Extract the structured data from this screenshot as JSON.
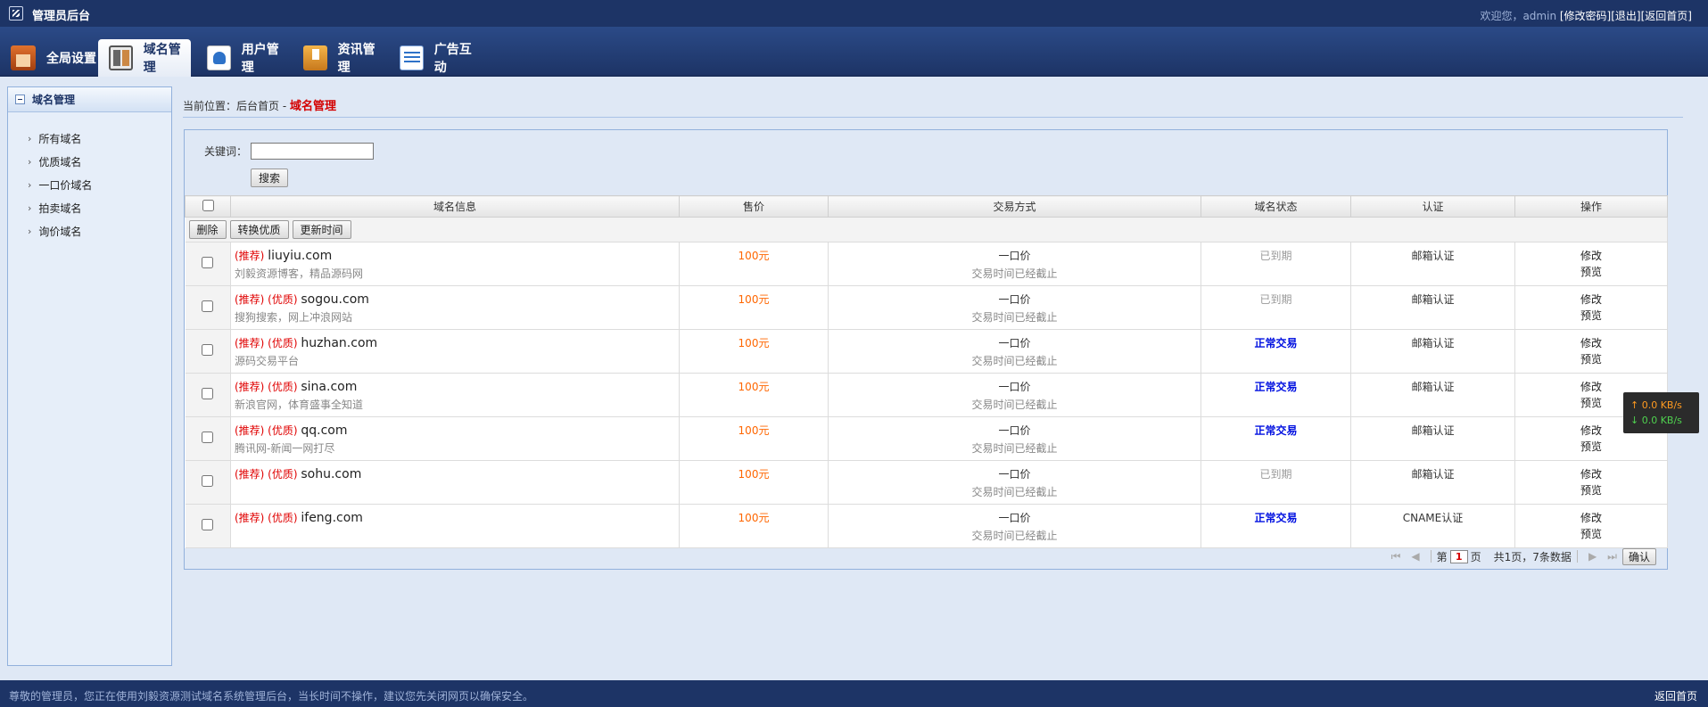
{
  "header": {
    "title": "管理员后台",
    "welcome": "欢迎您，admin ",
    "links": [
      "[修改密码]",
      "[退出]",
      "[返回首页]"
    ]
  },
  "nav": {
    "tabs": [
      {
        "label": "全局设置",
        "icon": "settings-icon"
      },
      {
        "label": "域名管理",
        "icon": "domain-icon",
        "active": true
      },
      {
        "label": "用户管理",
        "icon": "user-icon"
      },
      {
        "label": "资讯管理",
        "icon": "news-icon"
      },
      {
        "label": "广告互动",
        "icon": "ad-icon"
      }
    ]
  },
  "sidebar": {
    "title": "域名管理",
    "items": [
      "所有域名",
      "优质域名",
      "一口价域名",
      "拍卖域名",
      "询价域名"
    ]
  },
  "breadcrumb": {
    "prefix": "当前位置：",
    "home": "后台首页",
    "sep": " - ",
    "current": "域名管理"
  },
  "search": {
    "label": "关键词：",
    "value": "",
    "button": "搜索"
  },
  "table": {
    "headers": [
      "域名信息",
      "售价",
      "交易方式",
      "域名状态",
      "认证",
      "操作"
    ],
    "actions": [
      "删除",
      "转换优质",
      "更新时间"
    ],
    "rows": [
      {
        "tags": "(推荐)",
        "domain": "liuyiu.com",
        "desc": "刘毅资源博客，精品源码网",
        "price": "100元",
        "way": "一口价",
        "way_note": "交易时间已经截止",
        "status": "已到期",
        "status_type": "expired",
        "cert": "邮箱认证",
        "op1": "修改",
        "op2": "预览"
      },
      {
        "tags": "(推荐) (优质)",
        "domain": "sogou.com",
        "desc": "搜狗搜索，网上冲浪网站",
        "price": "100元",
        "way": "一口价",
        "way_note": "交易时间已经截止",
        "status": "已到期",
        "status_type": "expired",
        "cert": "邮箱认证",
        "op1": "修改",
        "op2": "预览"
      },
      {
        "tags": "(推荐) (优质)",
        "domain": "huzhan.com",
        "desc": "源码交易平台",
        "price": "100元",
        "way": "一口价",
        "way_note": "交易时间已经截止",
        "status": "正常交易",
        "status_type": "normal",
        "cert": "邮箱认证",
        "op1": "修改",
        "op2": "预览"
      },
      {
        "tags": "(推荐) (优质)",
        "domain": "sina.com",
        "desc": "新浪官网，体育盛事全知道",
        "price": "100元",
        "way": "一口价",
        "way_note": "交易时间已经截止",
        "status": "正常交易",
        "status_type": "normal",
        "cert": "邮箱认证",
        "op1": "修改",
        "op2": "预览"
      },
      {
        "tags": "(推荐) (优质)",
        "domain": "qq.com",
        "desc": "腾讯网-新闻一网打尽",
        "price": "100元",
        "way": "一口价",
        "way_note": "交易时间已经截止",
        "status": "正常交易",
        "status_type": "normal",
        "cert": "邮箱认证",
        "op1": "修改",
        "op2": "预览"
      },
      {
        "tags": "(推荐) (优质)",
        "domain": "sohu.com",
        "desc": "",
        "price": "100元",
        "way": "一口价",
        "way_note": "交易时间已经截止",
        "status": "已到期",
        "status_type": "expired",
        "cert": "邮箱认证",
        "op1": "修改",
        "op2": "预览"
      },
      {
        "tags": "(推荐) (优质)",
        "domain": "ifeng.com",
        "desc": "",
        "price": "100元",
        "way": "一口价",
        "way_note": "交易时间已经截止",
        "status": "正常交易",
        "status_type": "normal",
        "cert": "CNAME认证",
        "op1": "修改",
        "op2": "预览"
      }
    ]
  },
  "pager": {
    "page_prefix": "第",
    "page": "1",
    "page_suffix": "页",
    "summary": "共1页，7条数据",
    "confirm": "确认"
  },
  "speed": {
    "up": "↑ 0.0 KB/s",
    "down": "↓ 0.0 KB/s"
  },
  "footer": {
    "message": "尊敬的管理员，您正在使用刘毅资源测试域名系统管理后台，当长时间不操作，建议您先关闭网页以确保安全。",
    "back": "返回首页"
  }
}
